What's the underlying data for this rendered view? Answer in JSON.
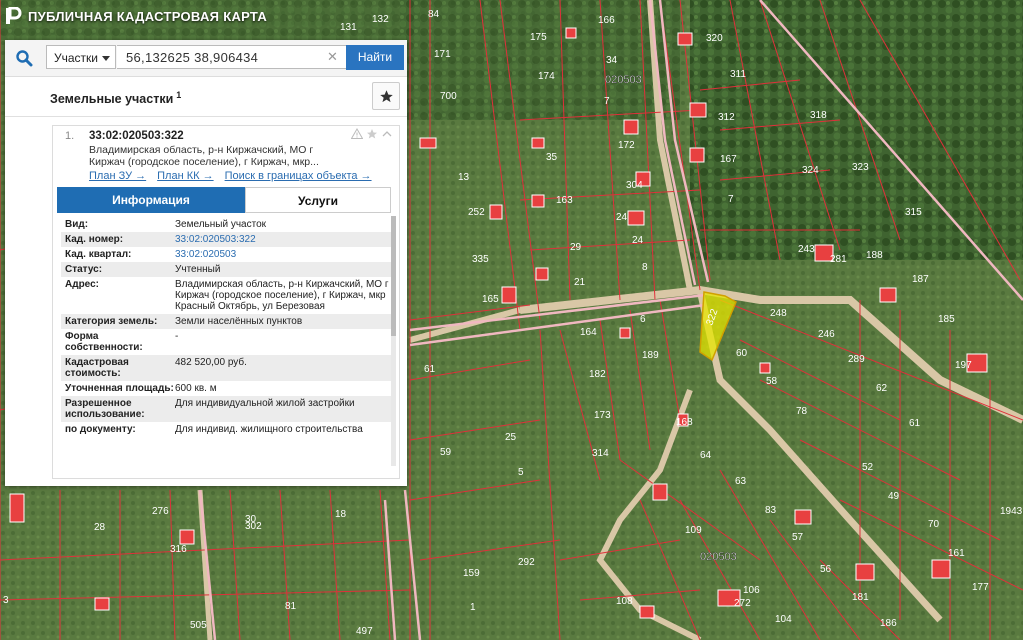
{
  "app": {
    "title": "ПУБЛИЧНАЯ КАДАСТРОВАЯ КАРТА"
  },
  "search": {
    "type_selected": "Участки",
    "query": "56,132625 38,906434",
    "find_label": "Найти"
  },
  "results": {
    "header": "Земельные участки",
    "count": "1",
    "item": {
      "index": "1.",
      "cadastral_id": "33:02:020503:322",
      "address_short": "Владимирская область, р-н Киржачский, МО г Киржач (городское поселение), г Киржач, мкр...",
      "links": {
        "plan_zu": "План ЗУ →",
        "plan_kk": "План КК →",
        "search_in_bounds": "Поиск в границах объекта →"
      },
      "tabs": {
        "info": "Информация",
        "services": "Услуги"
      },
      "rows": [
        {
          "k": "Вид:",
          "v": "Земельный участок"
        },
        {
          "k": "Кад. номер:",
          "v": "33:02:020503:322"
        },
        {
          "k": "Кад. квартал:",
          "v": "33:02:020503"
        },
        {
          "k": "Статус:",
          "v": "Учтенный"
        },
        {
          "k": "Адрес:",
          "v": "Владимирская область, р-н Киржачский, МО г Киржач (городское поселение), г Киржач, мкр Красный Октябрь, ул Березовая"
        },
        {
          "k": "Категория земель:",
          "v": "Земли населённых пунктов"
        },
        {
          "k": "Форма собственности:",
          "v": "-"
        },
        {
          "k": "Кадастровая стоимость:",
          "v": "482 520,00 руб."
        },
        {
          "k": "Уточненная площадь:",
          "v": "600 кв. м"
        },
        {
          "k": "Разрешенное использование:",
          "v": "Для индивидуальной жилой застройки"
        },
        {
          "k": "по документу:",
          "v": "Для индивид. жилищного строительства"
        }
      ]
    }
  },
  "map": {
    "colors": {
      "parcel_border": "#e0303a",
      "road": "#e8b9b9",
      "highlight": "#e6e600",
      "building": "#e84040"
    },
    "quarter_labels": [
      "020503",
      "020503"
    ],
    "selected_parcel_label": "322",
    "parcel_labels": [
      "84",
      "131",
      "132",
      "166",
      "175",
      "320",
      "171",
      "34",
      "174",
      "311",
      "700",
      "7",
      "312",
      "318",
      "172",
      "167",
      "35",
      "323",
      "324",
      "13",
      "304",
      "163",
      "252",
      "7",
      "24",
      "315",
      "335",
      "29",
      "24",
      "243",
      "281",
      "8",
      "165",
      "21",
      "188",
      "187",
      "6",
      "248",
      "61",
      "164",
      "185",
      "246",
      "189",
      "60",
      "289",
      "182",
      "197",
      "58",
      "62",
      "78",
      "173",
      "168",
      "61",
      "25",
      "314",
      "52",
      "59",
      "5",
      "64",
      "63",
      "83",
      "49",
      "1943",
      "276",
      "30",
      "28",
      "18",
      "302",
      "109",
      "57",
      "70",
      "316",
      "161",
      "292",
      "56",
      "159",
      "106",
      "177",
      "181",
      "3",
      "81",
      "108",
      "1",
      "272",
      "104",
      "186",
      "505",
      "497"
    ]
  }
}
